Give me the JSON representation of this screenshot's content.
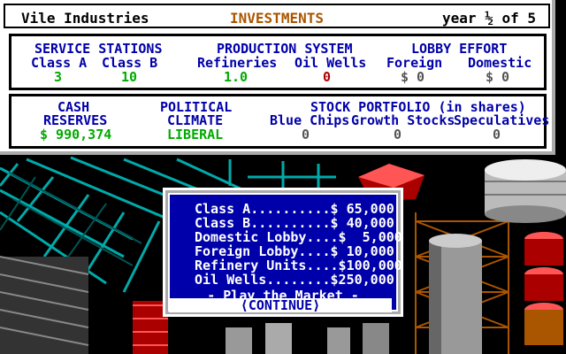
{
  "header": {
    "company": "Vile Industries",
    "screen_title": "INVESTMENTS",
    "year": "year ½ of 5"
  },
  "service_stations": {
    "heading": "SERVICE STATIONS",
    "class_a_label": "Class A",
    "class_b_label": "Class B",
    "class_a_value": "3",
    "class_b_value": "10"
  },
  "production_system": {
    "heading": "PRODUCTION SYSTEM",
    "refineries_label": "Refineries",
    "oil_wells_label": "Oil Wells",
    "refineries_value": "1.0",
    "oil_wells_value": "0"
  },
  "lobby_effort": {
    "heading": "LOBBY EFFORT",
    "foreign_label": "Foreign",
    "domestic_label": "Domestic",
    "foreign_value": "$ 0",
    "domestic_value": "$ 0"
  },
  "cash": {
    "heading_line1": "CASH",
    "heading_line2": "RESERVES",
    "value": "$ 990,374"
  },
  "political": {
    "heading_line1": "POLITICAL",
    "heading_line2": "CLIMATE",
    "value": "LIBERAL"
  },
  "stock_portfolio": {
    "heading": "STOCK PORTFOLIO (in shares)",
    "blue_chips_label": "Blue Chips",
    "growth_label": "Growth Stocks",
    "speculatives_label": "Speculatives",
    "blue_chips_value": "0",
    "growth_value": "0",
    "speculatives_value": "0"
  },
  "dialog": {
    "prices": [
      "Class A..........$ 65,000",
      "Class B..........$ 40,000",
      "Domestic Lobby....$  5,000",
      "Foreign Lobby....$ 10,000",
      "Refinery Units....$100,000",
      "Oil Wells........$250,000"
    ],
    "play_label": "- Play the Market -",
    "continue_label": "⟨CONTINUE⟩"
  },
  "colors": {
    "panel_label": "#0000aa",
    "good_value": "#00aa00",
    "bad_value": "#aa0000",
    "dialog_bg": "#0000aa"
  }
}
